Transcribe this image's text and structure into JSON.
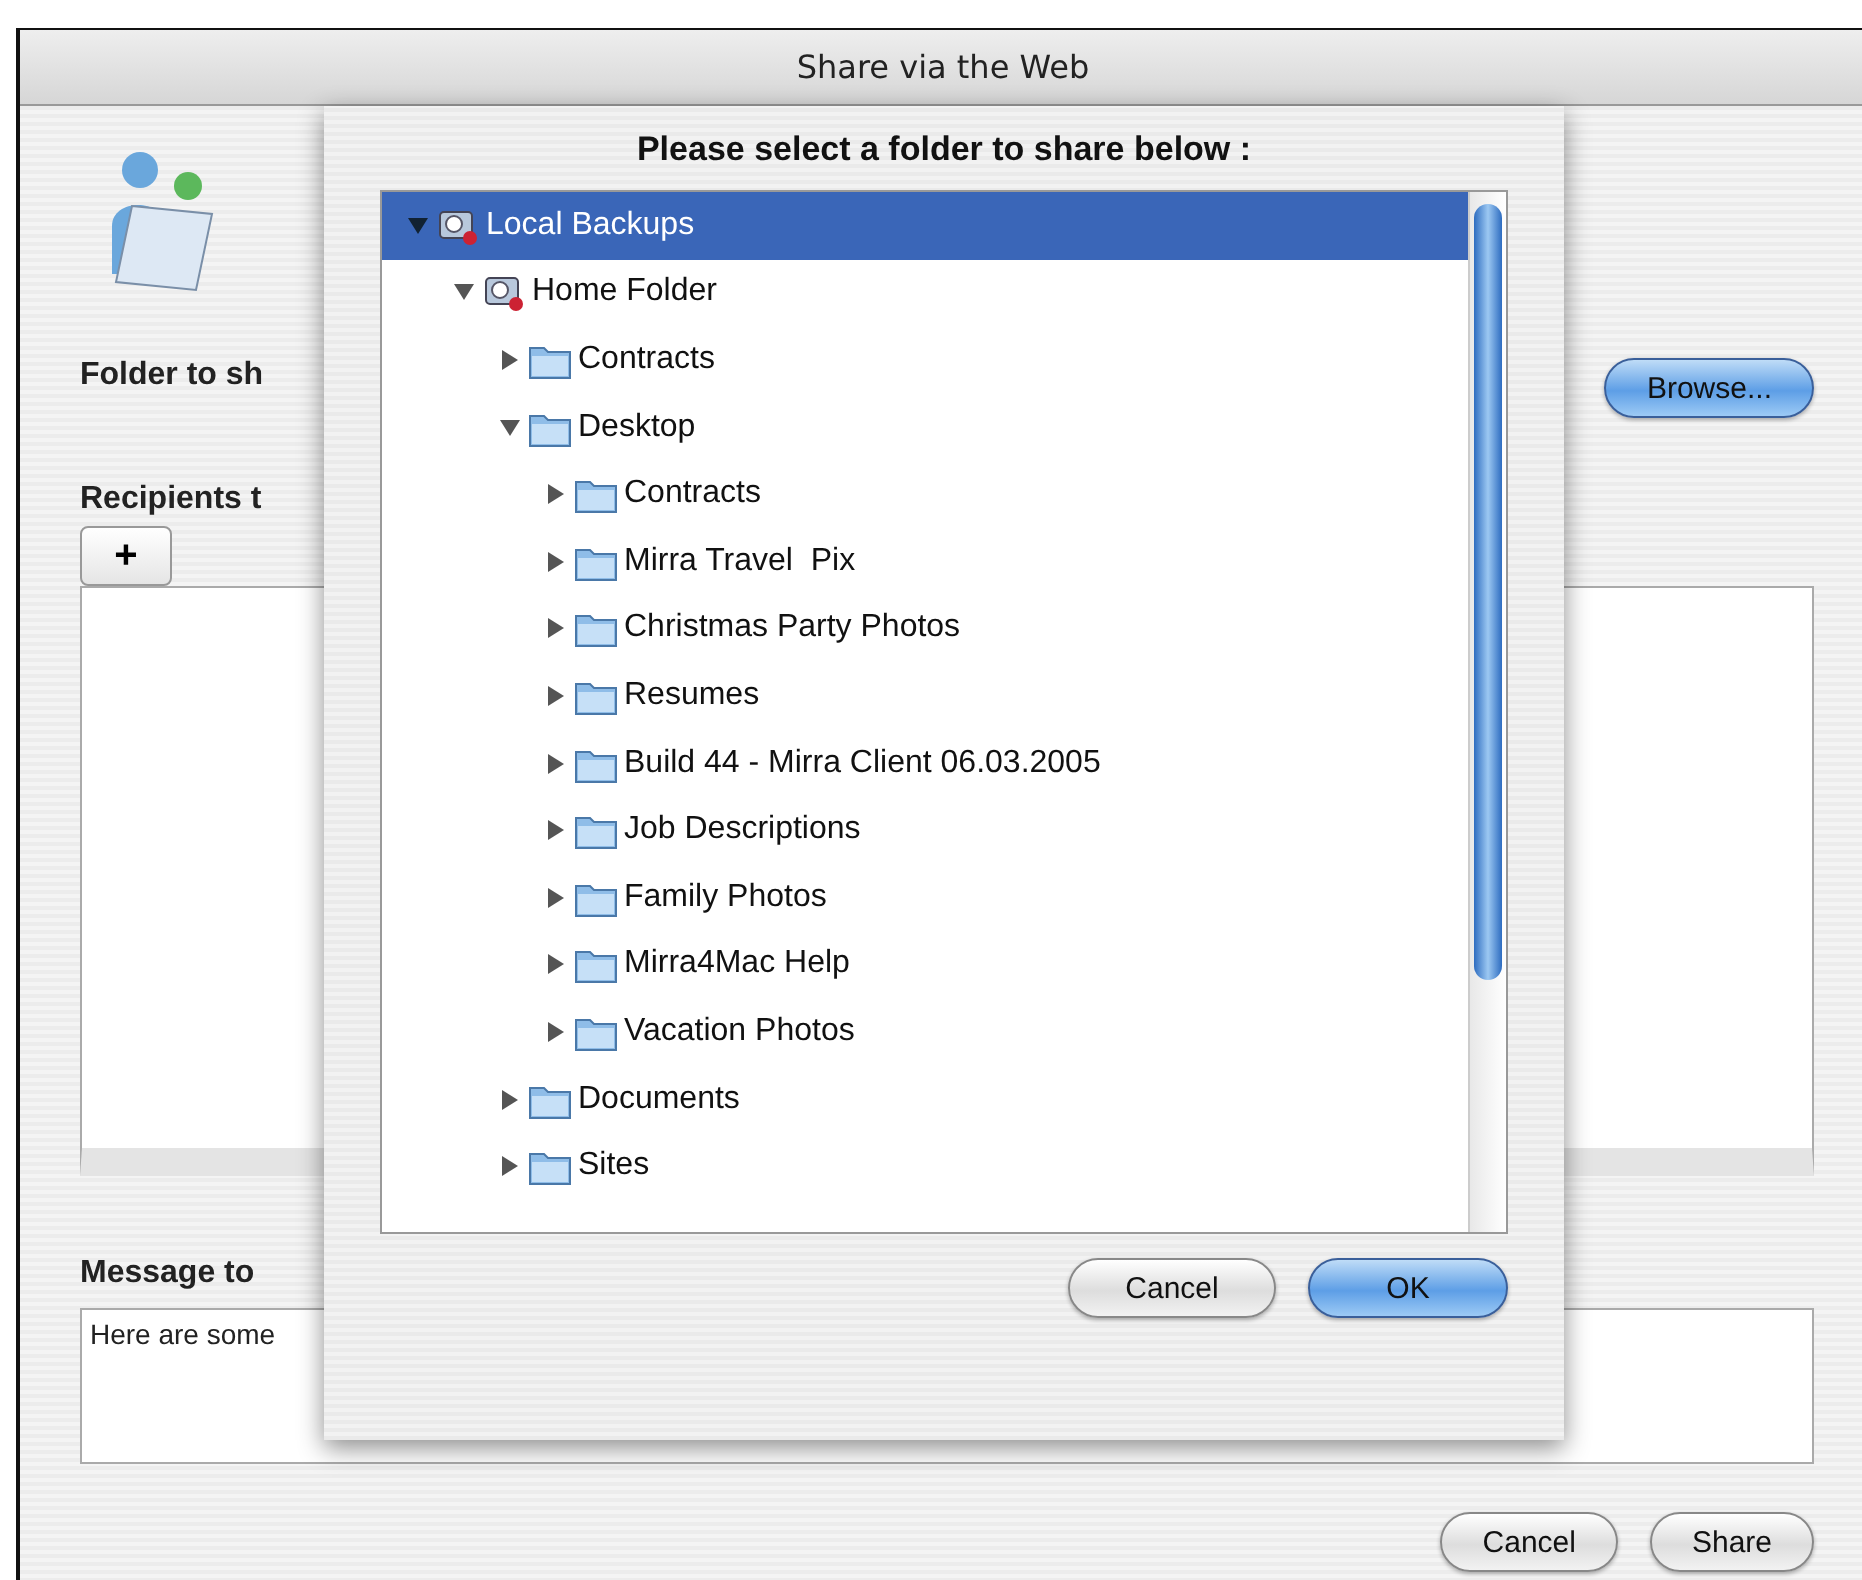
{
  "window": {
    "title": "Share via the Web"
  },
  "form": {
    "folder_label": "Folder to sh",
    "browse_button": "Browse...",
    "recipients_label": "Recipients t",
    "add_button": "+",
    "message_label": "Message to",
    "message_value": "Here are some"
  },
  "buttons": [
    "Cancel",
    "Share"
  ],
  "sheet": {
    "title": "Please select a folder to share below :",
    "tree": [
      {
        "label": "Local Backups",
        "kind": "drive",
        "expanded": true,
        "selected": true,
        "children": [
          {
            "label": "Home Folder",
            "kind": "drive",
            "expanded": true,
            "selected": false,
            "children": [
              {
                "label": "Contracts",
                "kind": "folder",
                "expanded": false,
                "selected": false
              },
              {
                "label": "Desktop",
                "kind": "folder",
                "expanded": true,
                "selected": false,
                "children": [
                  {
                    "label": "Contracts",
                    "kind": "folder",
                    "expanded": false,
                    "selected": false
                  },
                  {
                    "label": "Mirra Travel  Pix",
                    "kind": "folder",
                    "expanded": false,
                    "selected": false
                  },
                  {
                    "label": "Christmas Party Photos",
                    "kind": "folder",
                    "expanded": false,
                    "selected": false
                  },
                  {
                    "label": "Resumes",
                    "kind": "folder",
                    "expanded": false,
                    "selected": false
                  },
                  {
                    "label": "Build 44 - Mirra Client 06.03.2005",
                    "kind": "folder",
                    "expanded": false,
                    "selected": false
                  },
                  {
                    "label": "Job Descriptions",
                    "kind": "folder",
                    "expanded": false,
                    "selected": false
                  },
                  {
                    "label": "Family Photos",
                    "kind": "folder",
                    "expanded": false,
                    "selected": false
                  },
                  {
                    "label": "Mirra4Mac Help",
                    "kind": "folder",
                    "expanded": false,
                    "selected": false
                  },
                  {
                    "label": "Vacation Photos",
                    "kind": "folder",
                    "expanded": false,
                    "selected": false
                  }
                ]
              },
              {
                "label": "Documents",
                "kind": "folder",
                "expanded": false,
                "selected": false
              },
              {
                "label": "Sites",
                "kind": "folder",
                "expanded": false,
                "selected": false
              }
            ]
          }
        ]
      }
    ],
    "buttons": [
      {
        "label": "Cancel",
        "kind": "plain"
      },
      {
        "label": "OK",
        "kind": "default"
      }
    ]
  }
}
